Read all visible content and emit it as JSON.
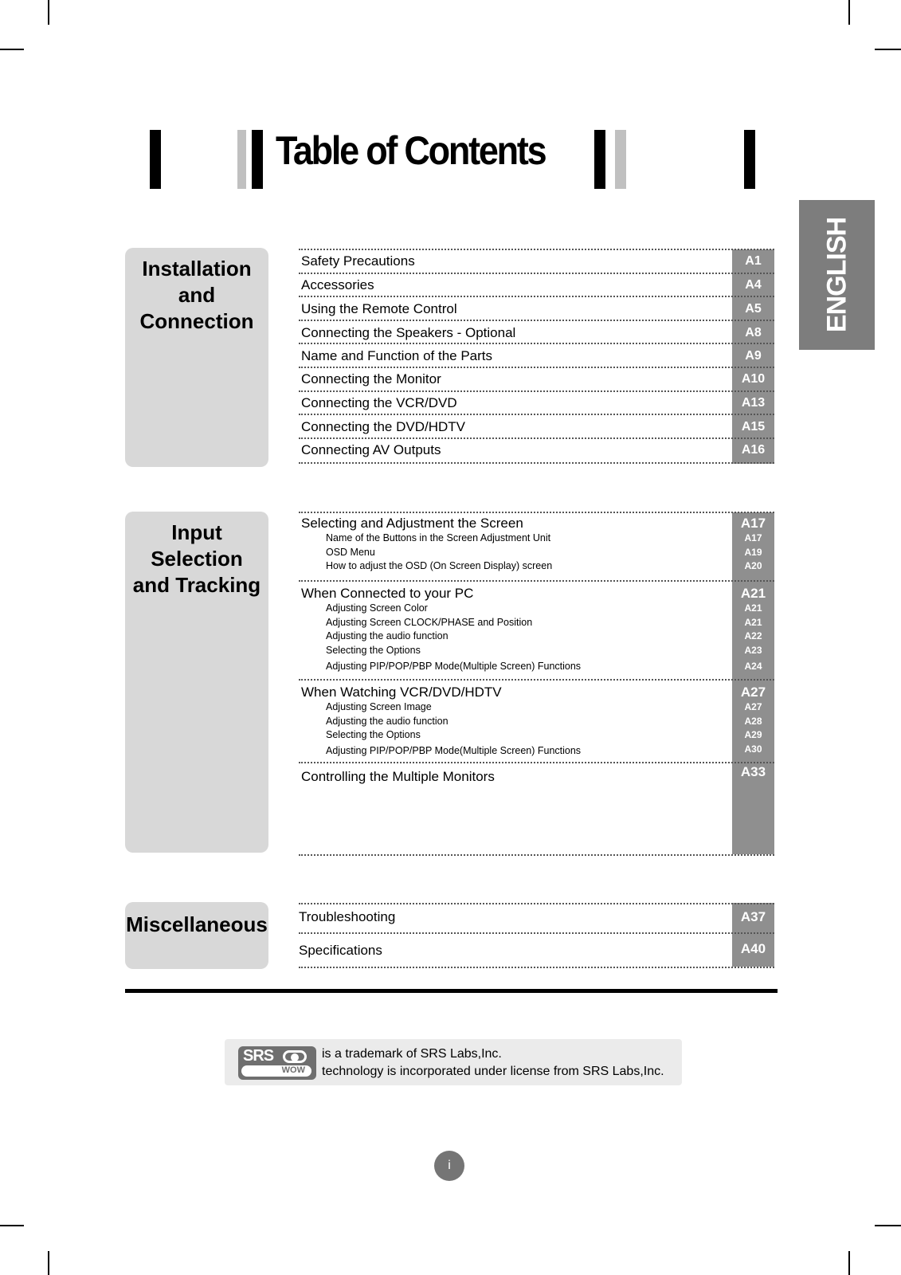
{
  "header": {
    "title": "Table of Contents",
    "language_tab": "ENGLISH"
  },
  "colors": {
    "section_box": "#d8d8d8",
    "page_column": "#8f8f8f",
    "language_tab": "#7d7d7d",
    "page_badge": "#757575"
  },
  "sections": [
    {
      "label_lines": [
        "Installation",
        "and",
        "Connection"
      ],
      "entries": [
        {
          "title": "Safety Precautions",
          "page": "A1"
        },
        {
          "title": "Accessories",
          "page": "A4"
        },
        {
          "title": "Using the Remote Control",
          "page": "A5"
        },
        {
          "title": "Connecting the Speakers - Optional",
          "page": "A8"
        },
        {
          "title": "Name and Function of the Parts",
          "page": "A9"
        },
        {
          "title": "Connecting the Monitor",
          "page": "A10"
        },
        {
          "title": "Connecting the VCR/DVD",
          "page": "A13"
        },
        {
          "title": "Connecting the DVD/HDTV",
          "page": "A15"
        },
        {
          "title": "Connecting AV Outputs",
          "page": "A16"
        }
      ]
    },
    {
      "label_lines": [
        "Input",
        "Selection",
        "and Tracking"
      ],
      "groups": [
        {
          "title": "Selecting and Adjustment the Screen",
          "page": "A17",
          "subs": [
            {
              "title": "Name of the Buttons in the Screen Adjustment Unit",
              "page": "A17"
            },
            {
              "title": "OSD Menu",
              "page": "A19"
            },
            {
              "title": "How to adjust the OSD (On Screen Display) screen",
              "page": "A20"
            }
          ]
        },
        {
          "title": "When Connected to your PC",
          "page": "A21",
          "subs": [
            {
              "title": "Adjusting Screen Color",
              "page": "A21"
            },
            {
              "title": "Adjusting Screen CLOCK/PHASE and Position",
              "page": "A21"
            },
            {
              "title": "Adjusting the audio function",
              "page": "A22"
            },
            {
              "title": "Selecting the Options",
              "page": "A23"
            },
            {
              "title": "Adjusting PIP/POP/PBP Mode(Multiple Screen) Functions",
              "page": "A24"
            }
          ]
        },
        {
          "title": "When Watching VCR/DVD/HDTV",
          "page": "A27",
          "subs": [
            {
              "title": "Adjusting Screen Image",
              "page": "A27"
            },
            {
              "title": "Adjusting the audio function",
              "page": "A28"
            },
            {
              "title": "Selecting the Options",
              "page": "A29"
            },
            {
              "title": "Adjusting PIP/POP/PBP Mode(Multiple Screen) Functions",
              "page": "A30"
            }
          ]
        },
        {
          "title": "Controlling the Multiple Monitors",
          "page": "A33",
          "subs": []
        }
      ]
    },
    {
      "label_lines": [
        "Miscellaneous"
      ],
      "entries": [
        {
          "title": "Troubleshooting",
          "page": "A37"
        },
        {
          "title": "Specifications",
          "page": "A40"
        }
      ]
    }
  ],
  "trademark": {
    "logo_text": "SRS",
    "logo_sub": "WOW",
    "line1": "is a trademark of SRS Labs,Inc.",
    "line2": "technology is incorporated under license from SRS Labs,Inc."
  },
  "footer": {
    "page_number": "i"
  }
}
